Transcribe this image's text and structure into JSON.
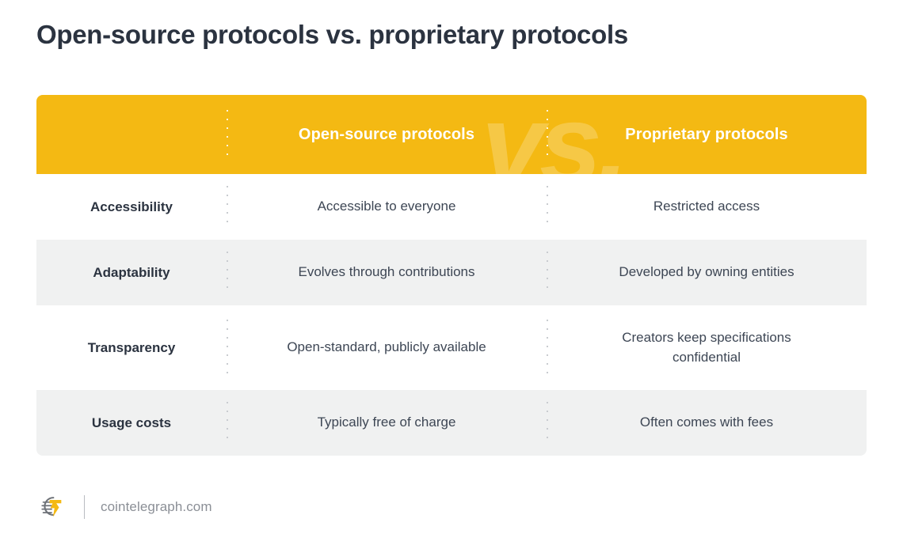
{
  "page": {
    "title": "Open-source protocols vs. proprietary protocols",
    "background_color": "#ffffff"
  },
  "colors": {
    "header_yellow": "#f4b913",
    "watermark": "rgba(255,255,255,0.22)",
    "row_shaded": "#f0f1f1",
    "row_plain": "#ffffff",
    "title_text": "#2b3340",
    "label_text": "#2b3340",
    "value_text": "#3d4654",
    "header_text": "#ffffff",
    "divider_dot": "#c9ccd0",
    "footer_text": "#8b8f96",
    "logo_bolt": "#f4b913",
    "logo_coin": "#6e7278"
  },
  "table": {
    "watermark": "vs.",
    "columns": [
      {
        "key": "criterion",
        "header": ""
      },
      {
        "key": "open_source",
        "header": "Open-source protocols"
      },
      {
        "key": "proprietary",
        "header": "Proprietary protocols"
      }
    ],
    "rows": [
      {
        "criterion": "Accessibility",
        "open_source": "Accessible to everyone",
        "proprietary": "Restricted access",
        "shaded": false,
        "tall": false
      },
      {
        "criterion": "Adaptability",
        "open_source": "Evolves through contributions",
        "proprietary": "Developed by owning entities",
        "shaded": true,
        "tall": false
      },
      {
        "criterion": "Transparency",
        "open_source": "Open-standard, publicly available",
        "proprietary": "Creators keep specifications confidential",
        "shaded": false,
        "tall": true
      },
      {
        "criterion": "Usage costs",
        "open_source": "Typically free of charge",
        "proprietary": "Often comes with fees",
        "shaded": true,
        "tall": false
      }
    ]
  },
  "footer": {
    "logo_icon": "cointelegraph-coin-stack-bolt-icon",
    "site": "cointelegraph.com"
  }
}
